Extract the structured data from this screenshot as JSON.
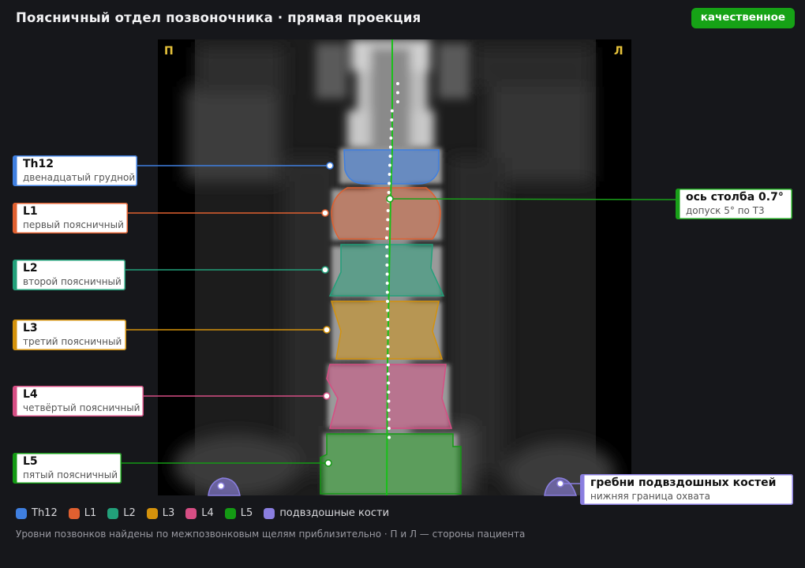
{
  "header": {
    "title": "Поясничный отдел позвоночника · прямая проекция",
    "badge": "качественное"
  },
  "image": {
    "side_left": "П",
    "side_right": "Л"
  },
  "vertebrae": [
    {
      "id": "Th12",
      "name": "Th12",
      "desc": "двенадцатый грудной",
      "color": "#3f7fe0"
    },
    {
      "id": "L1",
      "name": "L1",
      "desc": "первый поясничный",
      "color": "#e06030"
    },
    {
      "id": "L2",
      "name": "L2",
      "desc": "второй поясничный",
      "color": "#22a07a"
    },
    {
      "id": "L3",
      "name": "L3",
      "desc": "третий поясничный",
      "color": "#d4920c"
    },
    {
      "id": "L4",
      "name": "L4",
      "desc": "четвёртый поясничный",
      "color": "#d64e84"
    },
    {
      "id": "L5",
      "name": "L5",
      "desc": "пятый поясничный",
      "color": "#149a14"
    }
  ],
  "axis_callout": {
    "name": "ось столба 0.7°",
    "desc": "допуск 5° по Т3",
    "color": "#19a019"
  },
  "iliac_callout": {
    "name": "гребни подвздошных костей",
    "desc": "нижняя граница охвата",
    "color": "#8a7ee0"
  },
  "legend": [
    {
      "label": "Th12",
      "color": "#3f7fe0"
    },
    {
      "label": "L1",
      "color": "#e06030"
    },
    {
      "label": "L2",
      "color": "#22a07a"
    },
    {
      "label": "L3",
      "color": "#d4920c"
    },
    {
      "label": "L4",
      "color": "#d64e84"
    },
    {
      "label": "L5",
      "color": "#149a14"
    },
    {
      "label": "подвздошные кости",
      "color": "#8a7ee0"
    }
  ],
  "footer": {
    "note": "Уровни позвонков найдены по межпозвонковым щелям приблизительно · П и Л — стороны пациента"
  }
}
